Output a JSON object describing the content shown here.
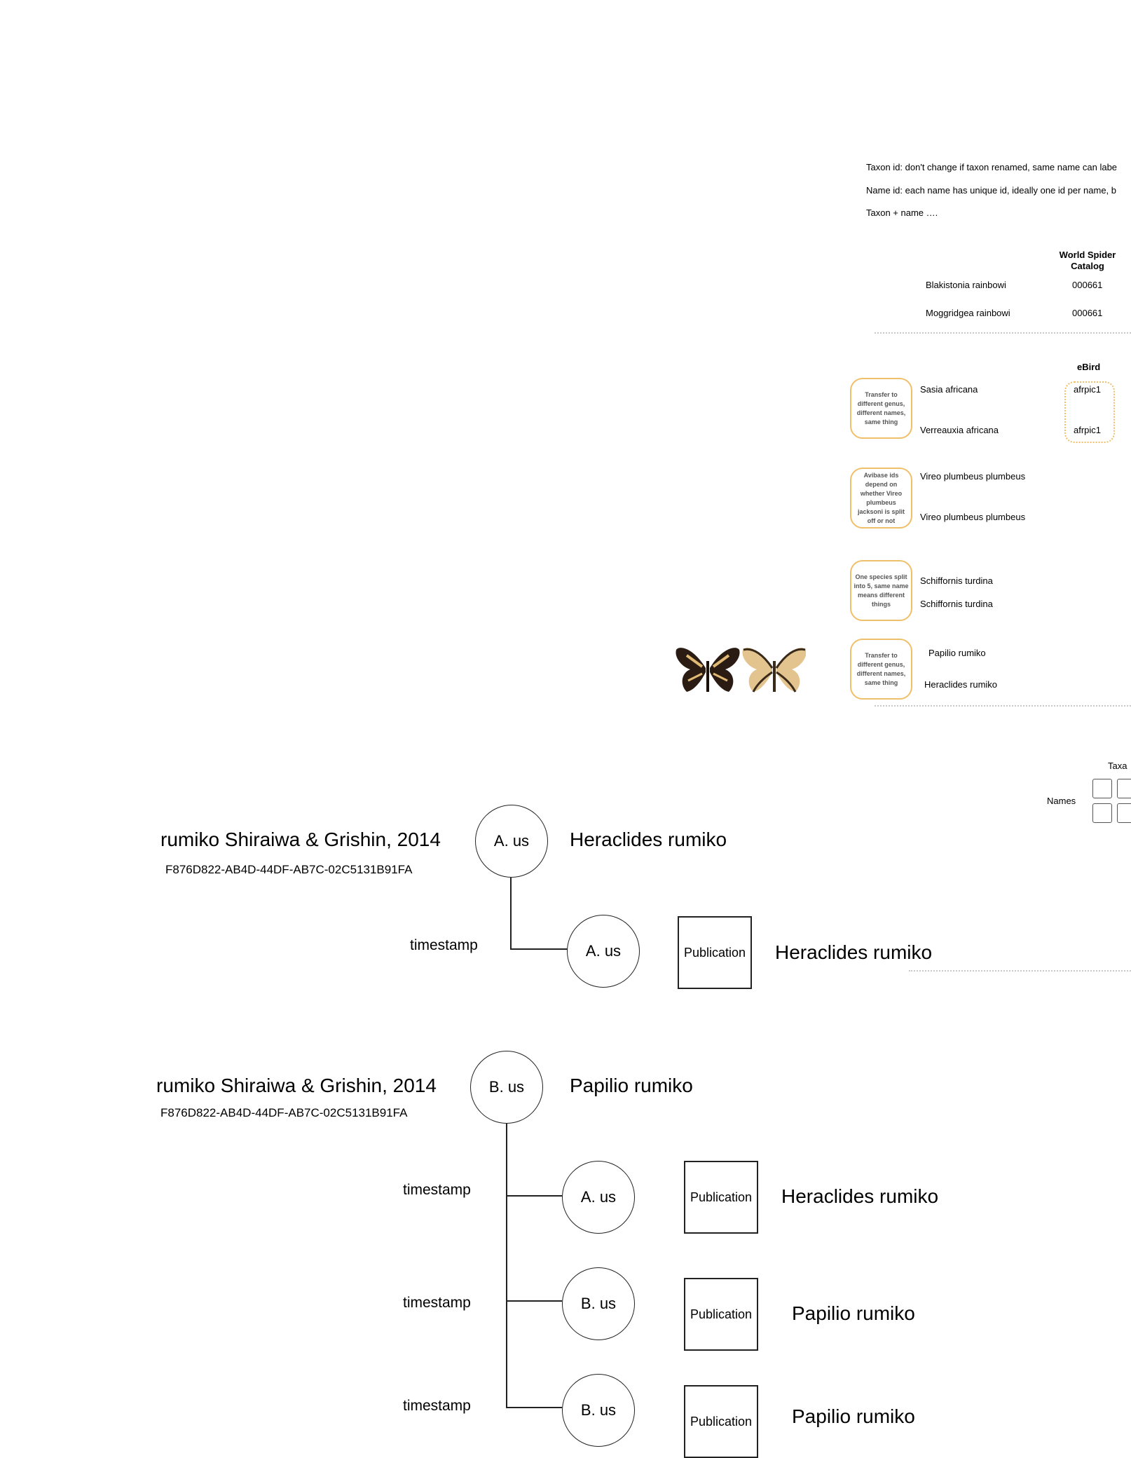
{
  "notes": {
    "taxon_id": "Taxon id: don't change if taxon renamed, same name can labe",
    "name_id": "Name id: each name has unique id, ideally one id per name, b",
    "taxon_name": "Taxon + name …."
  },
  "wsc": {
    "header": "World Spider Catalog",
    "rows": [
      {
        "name": "Blakistonia rainbowi",
        "id": "000661"
      },
      {
        "name": "Moggridgea rainbowi",
        "id": "000661"
      }
    ]
  },
  "ebird": {
    "header": "eBird",
    "rows": [
      {
        "name": "Sasia africana",
        "id": "afrpic1"
      },
      {
        "name": "Verreauxia africana",
        "id": "afrpic1"
      }
    ]
  },
  "callouts": {
    "transfer1": "Transfer to different genus, different names, same thing",
    "avibase": "Avibase ids depend on whether Vireo plumbeus jacksoni is split off or not",
    "split": "One species split into 5, same name means different things",
    "transfer2": "Transfer to different genus, different names, same thing"
  },
  "vireo": [
    "Vireo plumbeus plumbeus",
    "Vireo plumbeus plumbeus"
  ],
  "schiffornis": [
    "Schiffornis turdina",
    "Schiffornis turdina"
  ],
  "papilio": [
    "Papilio rumiko",
    "Heraclides rumiko"
  ],
  "grid": {
    "taxa": "Taxa",
    "names": "Names"
  },
  "diagram1": {
    "title": "rumiko Shiraiwa & Grishin, 2014",
    "uuid": "F876D822-AB4D-44DF-AB7C-02C5131B91FA",
    "root": {
      "label": "A. us",
      "name": "Heraclides rumiko"
    },
    "children": [
      {
        "timestamp": "timestamp",
        "label": "A. us",
        "pub": "Publication",
        "name": "Heraclides rumiko"
      }
    ]
  },
  "diagram2": {
    "title": "rumiko Shiraiwa & Grishin, 2014",
    "uuid": "F876D822-AB4D-44DF-AB7C-02C5131B91FA",
    "root": {
      "label": "B. us",
      "name": "Papilio rumiko"
    },
    "children": [
      {
        "timestamp": "timestamp",
        "label": "A. us",
        "pub": "Publication",
        "name": "Heraclides rumiko"
      },
      {
        "timestamp": "timestamp",
        "label": "B. us",
        "pub": "Publication",
        "name": "Papilio rumiko"
      },
      {
        "timestamp": "timestamp",
        "label": "B. us",
        "pub": "Publication",
        "name": "Papilio rumiko"
      }
    ]
  }
}
